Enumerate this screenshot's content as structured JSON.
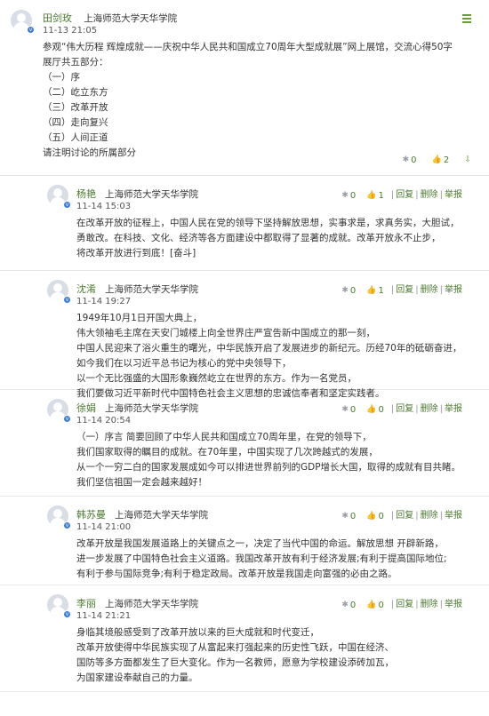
{
  "main": {
    "author": "田剑玫",
    "school": "上海师范大学天华学院",
    "time": "11-13 21:05",
    "lines": [
      "参观“伟大历程  辉煌成就——庆祝中华人民共和国成立70周年大型成就展”网上展馆，交流心得50字",
      "展厅共五部分：",
      "（一）序",
      "（二）屹立东方",
      "（三）改革开放",
      "（四）走向复兴",
      "（五）人间正道",
      "请注明讨论的所属部分"
    ],
    "stats": {
      "a": "0",
      "like": "2",
      "more": ""
    }
  },
  "replies": [
    {
      "author": "杨艳",
      "school": "上海师范大学天华学院",
      "time": "11-14 15:03",
      "a": "0",
      "like": "1",
      "reply_label": "回复",
      "delete_label": "删除",
      "report_label": "举报",
      "lines": [
        "在改革开放的征程上，中国人民在党的领导下坚持解放思想，实事求是，求真务实，大胆试，",
        "勇敢改。在科技、文化、经济等各方面建设中都取得了显著的成就。改革开放永不止步，",
        "将改革开放进行到底！[奋斗]"
      ]
    },
    {
      "author": "沈淆",
      "school": "上海师范大学天华学院",
      "time": "11-14 19:27",
      "a": "0",
      "like": "1",
      "reply_label": "回复",
      "delete_label": "删除",
      "report_label": "举报",
      "lines": [
        "1949年10月1日开国大典上，",
        "伟大领袖毛主席在天安门城楼上向全世界庄严宣告新中国成立的那一刻，",
        "中国人民迎来了浴火重生的曙光，中华民族开启了发展进步的新纪元。历经70年的砥砺奋进，",
        "如今我们在以习近平总书记为核心的党中央领导下，",
        "以一个无比强盛的大国形象巍然屹立在世界的东方。作为一名党员，",
        "我们要做习近平新时代中国特色社会主义思想的忠诚信奉者和坚定实践者。"
      ]
    },
    {
      "author": "徐娟",
      "school": "上海师范大学天华学院",
      "time": "11-14 20:54",
      "a": "0",
      "like": "0",
      "reply_label": "回复",
      "delete_label": "删除",
      "report_label": "举报",
      "lines": [
        "（一）序言 简要回顾了中华人民共和国成立70周年里，在党的领导下，",
        "我们国家取得的瞩目的成就。在70年里，中国实现了几次跨越式的发展，",
        "从一个一穷二白的国家发展成如今可以排进世界前列的GDP增长大国，取得的成就有目共睹。",
        "我们坚信祖国一定会越来越好！"
      ]
    },
    {
      "author": "韩苏曼",
      "school": "上海师范大学天华学院",
      "time": "11-14 21:00",
      "a": "0",
      "like": "0",
      "reply_label": "回复",
      "delete_label": "删除",
      "report_label": "举报",
      "lines": [
        "改革开放是我国发展道路上的关键点之一，决定了当代中国的命运。解放思想 开辟新路，",
        "进一步发展了中国特色社会主义道路。我国改革开放有利于经济发展;有利于提高国际地位;",
        "有利于参与国际竞争;有利于稳定政局。改革开放是我国走向富强的必由之路。"
      ]
    },
    {
      "author": "李丽",
      "school": "上海师范大学天华学院",
      "time": "11-14 21:21",
      "a": "0",
      "like": "0",
      "reply_label": "回复",
      "delete_label": "删除",
      "report_label": "举报",
      "lines": [
        "身临其境般感受到了改革开放以来的巨大成就和时代变迁，",
        "改革开放使得中华民族实现了从富起来打强起来的历史性飞跃，中国在经济、",
        "国防等多方面都发生了巨大变化。作为一名教师，愿意为学校建设添砖加瓦，",
        "为国家建设奉献自己的力量。"
      ]
    }
  ],
  "colors": {
    "accent": "#4a7a2e",
    "badge": "#3b7ddd",
    "divider": "#e6e6e6"
  },
  "icons": {
    "menu": "menu-icon",
    "dislike": "pin-icon",
    "like": "thumbs-up-icon",
    "verified": "verified-badge-icon"
  }
}
